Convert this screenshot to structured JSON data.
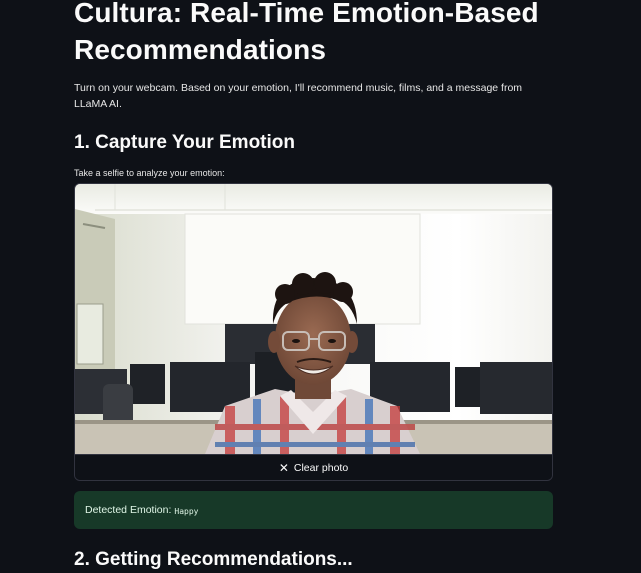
{
  "header": {
    "title": "Cultura: Real-Time Emotion-Based Recommendations",
    "intro": "Turn on your webcam. Based on your emotion, I'll recommend music, films, and a message from LLaMA AI."
  },
  "capture": {
    "heading": "1. Capture Your Emotion",
    "camera_label": "Take a selfie to analyze your emotion:",
    "clear_button_label": "Clear photo",
    "clear_icon": "close-icon"
  },
  "result": {
    "label": "Detected Emotion:",
    "emotion": "Happy",
    "status_color": "#173928"
  },
  "recommendations": {
    "heading": "2. Getting Recommendations..."
  },
  "theme": {
    "background": "#0e1117",
    "text": "#fafafa",
    "success": "#173928"
  }
}
